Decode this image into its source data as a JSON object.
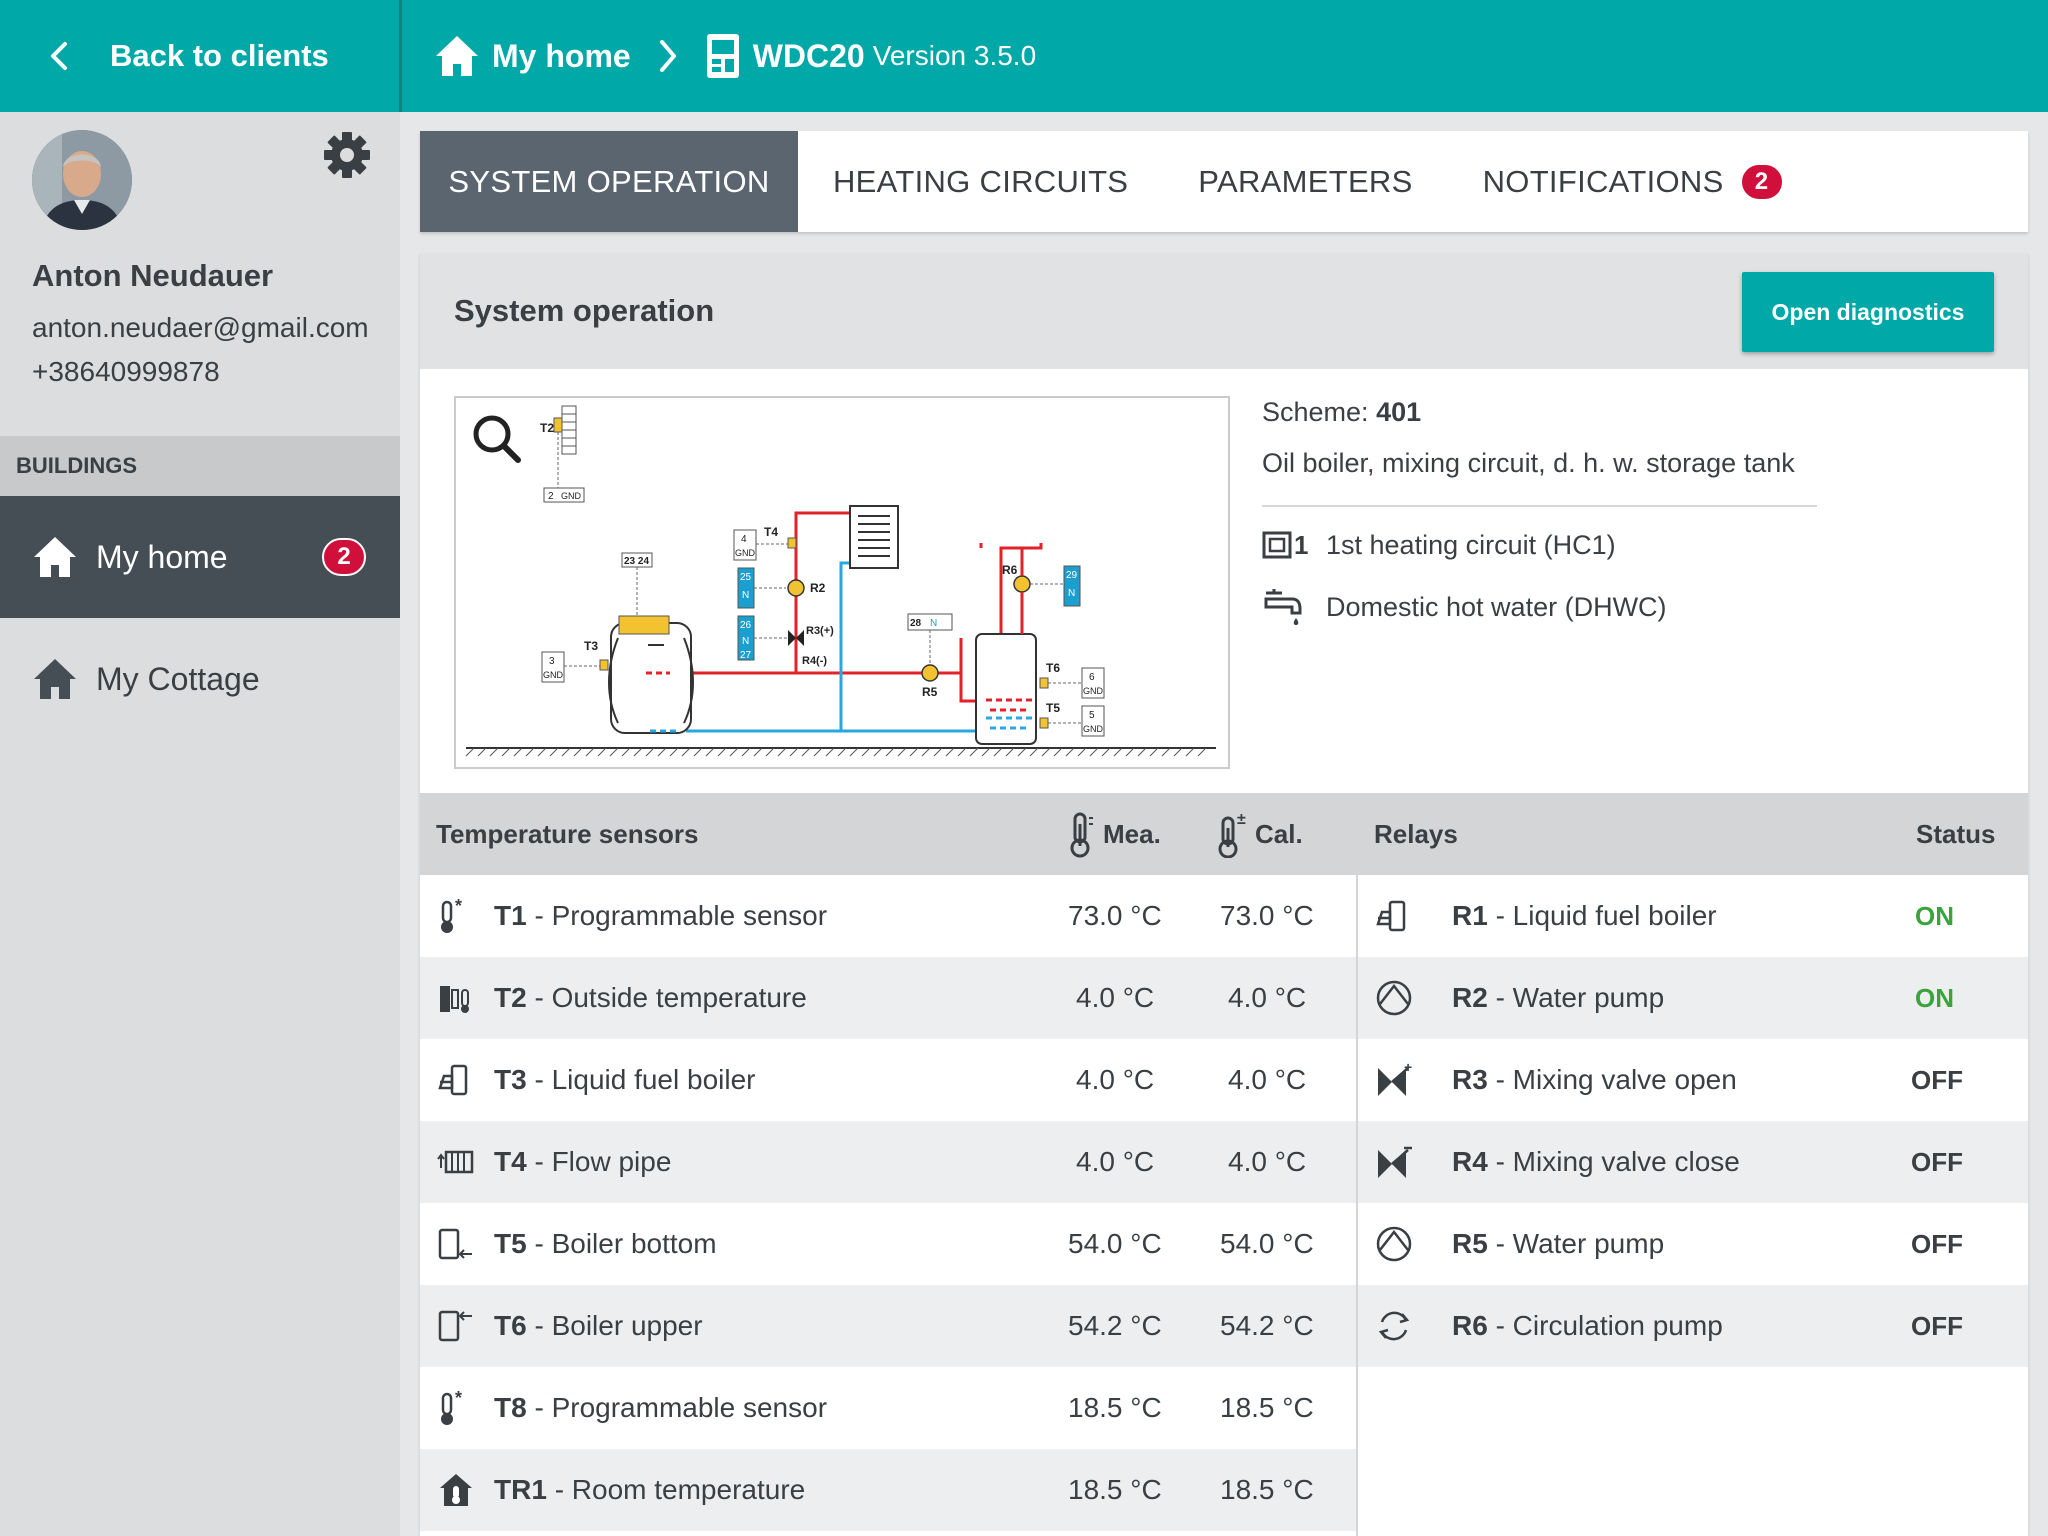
{
  "topbar": {
    "back_label": "Back to clients",
    "home_label": "My home",
    "device_label": "WDC20",
    "version_label": "Version 3.5.0"
  },
  "user": {
    "name": "Anton Neudauer",
    "email": "anton.neudaer@gmail.com",
    "phone": "+38640999878"
  },
  "buildings": {
    "header": "BUILDINGS",
    "items": [
      {
        "label": "My home",
        "badge": "2"
      },
      {
        "label": "My Cottage"
      }
    ]
  },
  "tabs": [
    {
      "label": "SYSTEM OPERATION"
    },
    {
      "label": "HEATING CIRCUITS"
    },
    {
      "label": "PARAMETERS"
    },
    {
      "label": "NOTIFICATIONS",
      "badge": "2"
    }
  ],
  "panel": {
    "title": "System operation",
    "diagnostics_label": "Open diagnostics",
    "scheme_label": "Scheme:",
    "scheme_number": "401",
    "scheme_description": "Oil boiler, mixing circuit, d. h. w. storage tank",
    "circuits": [
      {
        "icon": "heating-circuit-icon",
        "index": "1",
        "label": "1st heating circuit (HC1)"
      },
      {
        "icon": "tap-icon",
        "label": "Domestic hot water (DHWC)"
      }
    ]
  },
  "sensors": {
    "header": "Temperature sensors",
    "mea_label": "Mea.",
    "cal_label": "Cal.",
    "rows": [
      {
        "code": "T1",
        "name": "- Programmable sensor",
        "mea": "73.0 °C",
        "cal": "73.0 °C",
        "icon": "programmable-sensor-icon"
      },
      {
        "code": "T2",
        "name": "- Outside temperature",
        "mea": "4.0 °C",
        "cal": "4.0 °C",
        "icon": "outside-temperature-icon"
      },
      {
        "code": "T3",
        "name": "- Liquid fuel boiler",
        "mea": "4.0 °C",
        "cal": "4.0 °C",
        "icon": "boiler-icon"
      },
      {
        "code": "T4",
        "name": "- Flow pipe",
        "mea": "4.0 °C",
        "cal": "4.0 °C",
        "icon": "flow-pipe-icon"
      },
      {
        "code": "T5",
        "name": "- Boiler bottom",
        "mea": "54.0 °C",
        "cal": "54.0 °C",
        "icon": "boiler-bottom-icon"
      },
      {
        "code": "T6",
        "name": "- Boiler upper",
        "mea": "54.2 °C",
        "cal": "54.2 °C",
        "icon": "boiler-upper-icon"
      },
      {
        "code": "T8",
        "name": "- Programmable sensor",
        "mea": "18.5 °C",
        "cal": "18.5 °C",
        "icon": "programmable-sensor-icon"
      },
      {
        "code": "TR1",
        "name": "- Room temperature",
        "mea": "18.5 °C",
        "cal": "18.5 °C",
        "icon": "room-temperature-icon"
      }
    ]
  },
  "relays": {
    "header": "Relays",
    "status_header": "Status",
    "rows": [
      {
        "code": "R1",
        "name": "- Liquid fuel boiler",
        "status": "ON",
        "icon": "boiler-icon"
      },
      {
        "code": "R2",
        "name": "- Water pump",
        "status": "ON",
        "icon": "pump-icon"
      },
      {
        "code": "R3",
        "name": "- Mixing valve open",
        "status": "OFF",
        "icon": "valve-open-icon"
      },
      {
        "code": "R4",
        "name": "- Mixing valve close",
        "status": "OFF",
        "icon": "valve-close-icon"
      },
      {
        "code": "R5",
        "name": "- Water pump",
        "status": "OFF",
        "icon": "pump-icon"
      },
      {
        "code": "R6",
        "name": "- Circulation pump",
        "status": "OFF",
        "icon": "circulation-pump-icon"
      }
    ]
  },
  "diagram": {
    "labels": {
      "t2": "T2",
      "t3": "T3",
      "t4": "T4",
      "t5": "T5",
      "t6": "T6",
      "r2": "R2",
      "r3": "R3(+)",
      "r4": "R4(-)",
      "r5": "R5",
      "r6": "R6",
      "gnd": "GND",
      "t2_terminal": "2",
      "t3_terminal": "3",
      "t4_terminal": "4",
      "t5_terminal": "5",
      "t6_terminal": "6",
      "boiler_terminal": "23 24",
      "r2_terminal": "25",
      "r3_terminal": "26",
      "r4_terminal": "27",
      "r5_terminal": "28",
      "r6_terminal": "29",
      "neutral": "N"
    }
  }
}
